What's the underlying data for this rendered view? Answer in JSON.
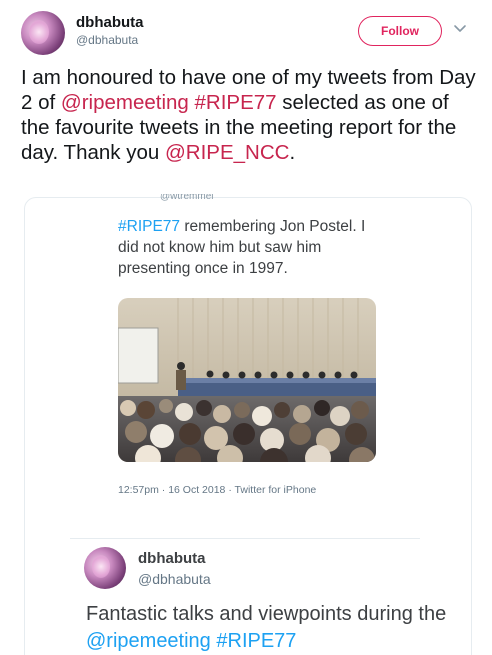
{
  "tweet": {
    "display_name": "dbhabuta",
    "handle": "@dbhabuta",
    "follow_label": "Follow",
    "text_1": "I am honoured to have one of my tweets from Day 2 of ",
    "mention_1": "@ripemeeting",
    "text_2": "  ",
    "hashtag_1": "#RIPE77",
    "text_3": " selected as one of the favourite tweets in the meeting report for the day. Thank you ",
    "mention_2": "@RIPE_NCC",
    "text_4": "."
  },
  "quoted": {
    "cut_handle": "@wtremmel",
    "hashtag": "#RIPE77",
    "text": " remembering Jon Postel. I did not know him but saw him presenting once in 1997.",
    "meta": "12:57pm · 16 Oct 2018 · Twitter for iPhone"
  },
  "reply": {
    "display_name": "dbhabuta",
    "handle": "@dbhabuta",
    "text_1": "Fantastic talks and viewpoints during the ",
    "mention": "@ripemeeting",
    "text_2": " ",
    "hashtag": "#RIPE77"
  },
  "colors": {
    "accent": "#e0245e",
    "link": "#1da1f2",
    "muted": "#657786"
  },
  "icons": {
    "chevron": "chevron-down-icon"
  }
}
